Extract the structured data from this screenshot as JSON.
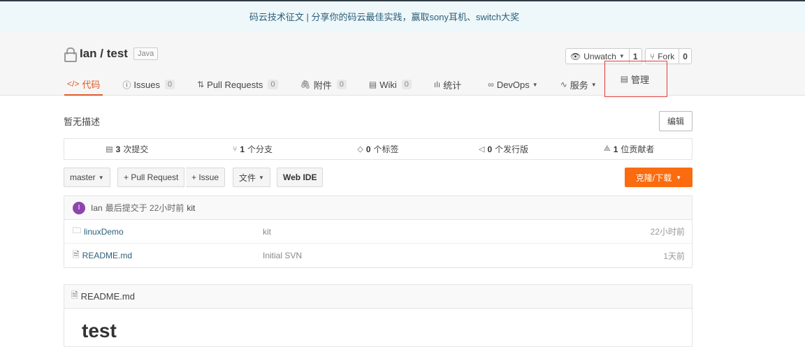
{
  "banner": {
    "text": "码云技术征文 | 分享你的码云最佳实践，赢取sony耳机、switch大奖"
  },
  "repo": {
    "owner_repo": "Ian / test",
    "language": "Java"
  },
  "header_buttons": {
    "watch": {
      "label": "Unwatch",
      "count": "1"
    },
    "fork": {
      "label": "Fork",
      "count": "0"
    }
  },
  "tabs": [
    {
      "label": "代码",
      "icon": "code-icon"
    },
    {
      "label": "Issues",
      "count": "0",
      "icon": "issue-icon"
    },
    {
      "label": "Pull Requests",
      "count": "0",
      "icon": "pull-request-icon"
    },
    {
      "label": "附件",
      "count": "0",
      "icon": "attachment-icon"
    },
    {
      "label": "Wiki",
      "count": "0",
      "icon": "wiki-icon"
    },
    {
      "label": "统计",
      "icon": "chart-icon"
    },
    {
      "label": "DevOps",
      "icon": "devops-icon"
    },
    {
      "label": "服务",
      "icon": "service-icon"
    },
    {
      "label": "管理",
      "icon": "manage-icon"
    }
  ],
  "description": "暂无描述",
  "edit_label": "编辑",
  "stats": [
    {
      "num": "3",
      "label": "次提交",
      "icon": "commit-icon"
    },
    {
      "num": "1",
      "label": "个分支",
      "icon": "branch-icon"
    },
    {
      "num": "0",
      "label": "个标签",
      "icon": "tag-icon"
    },
    {
      "num": "0",
      "label": "个发行版",
      "icon": "release-icon"
    },
    {
      "num": "1",
      "label": "位贡献者",
      "icon": "contributors-icon"
    }
  ],
  "toolbar": {
    "branch": "master",
    "pull_request": "+ Pull Request",
    "issue": "+ Issue",
    "file": "文件",
    "web_ide": "Web IDE",
    "clone": "克隆/下载"
  },
  "last_commit": {
    "avatar_letter": "I",
    "user": "Ian",
    "text": "最后提交于 22小时前",
    "message": "kit"
  },
  "files": [
    {
      "name": "linuxDemo",
      "type": "folder",
      "message": "kit",
      "time": "22小时前"
    },
    {
      "name": "README.md",
      "type": "file",
      "message": "Initial SVN",
      "time": "1天前"
    }
  ],
  "readme": {
    "filename": "README.md",
    "heading": "test"
  },
  "colors": {
    "accent": "#fa6c0f",
    "active_tab": "#e15a2a",
    "avatar": "#8e44ad"
  }
}
